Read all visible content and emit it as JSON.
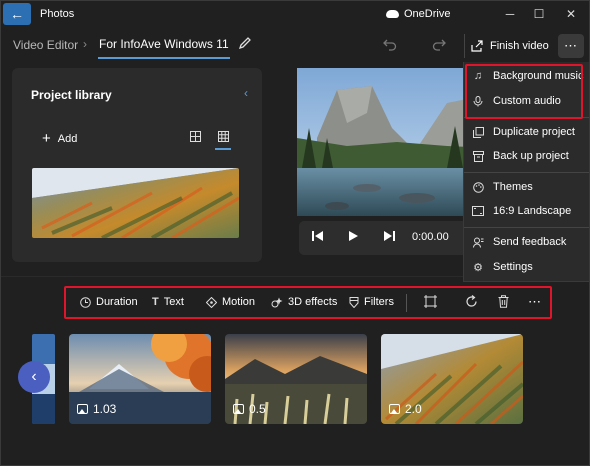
{
  "titlebar": {
    "app_title": "Photos",
    "onedrive_label": "OneDrive",
    "minimize": "─",
    "maximize": "☐",
    "close": "✕"
  },
  "header": {
    "breadcrumb_root": "Video Editor",
    "breadcrumb_sep": "›",
    "project_name": "For InfoAve Windows 11",
    "finish_label": "Finish video",
    "more_label": "⋯"
  },
  "library": {
    "title": "Project library",
    "add_label": "Add"
  },
  "player": {
    "time": "0:00.00"
  },
  "toolbar": {
    "duration": "Duration",
    "text": "Text",
    "motion": "Motion",
    "effects": "3D effects",
    "filters": "Filters",
    "more": "⋯"
  },
  "timeline": {
    "clips": [
      {
        "label": "1.03"
      },
      {
        "label": "0.5"
      },
      {
        "label": "2.0"
      }
    ]
  },
  "menu": {
    "items": [
      {
        "label": "Background music",
        "icon": "music-note-icon"
      },
      {
        "label": "Custom audio",
        "icon": "microphone-icon"
      },
      {
        "label": "Duplicate project",
        "icon": "duplicate-icon"
      },
      {
        "label": "Back up project",
        "icon": "archive-icon"
      },
      {
        "label": "Themes",
        "icon": "palette-icon"
      },
      {
        "label": "16:9 Landscape",
        "icon": "aspect-ratio-icon"
      },
      {
        "label": "Send feedback",
        "icon": "feedback-icon"
      },
      {
        "label": "Settings",
        "icon": "gear-icon"
      }
    ]
  },
  "colors": {
    "accent": "#5b9bd5",
    "highlight_red": "#e0142a",
    "scroll_button": "#4b5fc0",
    "background": "#202020"
  }
}
